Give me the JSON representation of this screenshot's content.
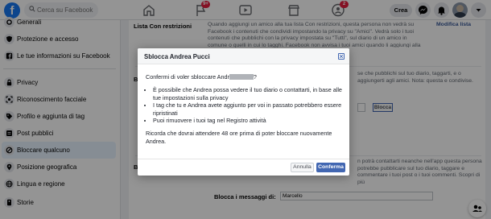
{
  "topbar": {
    "search_placeholder": "Cerca su Facebook",
    "notifications_badge": "9+",
    "groups_badge": "2",
    "create_label": "Crea"
  },
  "sidebar": {
    "items": [
      {
        "label": "Generali",
        "icon": "gear-icon"
      },
      {
        "label": "Protezione e accesso",
        "icon": "shield-icon"
      },
      {
        "label": "Le tue informazioni su Facebook",
        "icon": "facebook-icon"
      },
      {
        "label": "Privacy",
        "icon": "lock-icon"
      },
      {
        "label": "Riconoscimento facciale",
        "icon": "face-icon"
      },
      {
        "label": "Profilo e aggiunta di tag",
        "icon": "tag-icon"
      },
      {
        "label": "Post pubblici",
        "icon": "post-icon"
      },
      {
        "label": "Bloccare qualcuno",
        "icon": "block-icon",
        "active": true
      },
      {
        "label": "Posizione geografica",
        "icon": "location-icon"
      },
      {
        "label": "Lingua e regione",
        "icon": "globe-icon"
      },
      {
        "label": "Storie",
        "icon": "stories-icon"
      }
    ]
  },
  "main": {
    "restricted_title": "Lista Con restrizioni",
    "restricted_desc": "Quando aggiungi un amico alla tua lista Con restrizioni, questa persona non vedrà su Facebook i contenuti che condividi impostando la privacy su \"Amici\". Vedrà solo i tuoi contenuti che pubblichi con la privacy impostata su \"Tutti\", sul diario di un amico in comune o quelli in cui lo tagghi. Facebook non avvisa i tuoi amici quando li aggiungi alla lista Con",
    "edit_list_link": "Modifica lista",
    "block_users_title": "Bl",
    "block_users_desc": "se che pubblichi sul tuo diario, taggarti, e o aggiungerti agli amici. Nota: questa e condivise.",
    "block_button": "Blocca",
    "block_messages_title": "Bl",
    "block_messages_desc": "n potrà contattarti neanche nell'app questa persona potrebbe pubblicare sul tuo diario, taggare e commentare i tuoi post o i tuoi commenti. Scopri di più",
    "block_messages_label": "Blocca i messaggi di:",
    "block_messages_value": "Marcello"
  },
  "modal": {
    "title": "Sblocca Andrea Pucci",
    "question_prefix": "Confermi di voler sbloccare Andr",
    "question_suffix": "?",
    "bullets": [
      "È possibile che Andrea possa vedere il tuo diario o contattarti, in base alle tue impostazioni sulla privacy",
      "I tag che tu e Andrea avete aggiunto per voi in passato potrebbero essere ripristinati",
      "Puoi rimuovere i tuoi tag nel Registro attività"
    ],
    "note": "Ricorda che dovrai attendere 48 ore prima di poter bloccare nuovamente Andrea.",
    "cancel_label": "Annulla",
    "confirm_label": "Conferma"
  }
}
